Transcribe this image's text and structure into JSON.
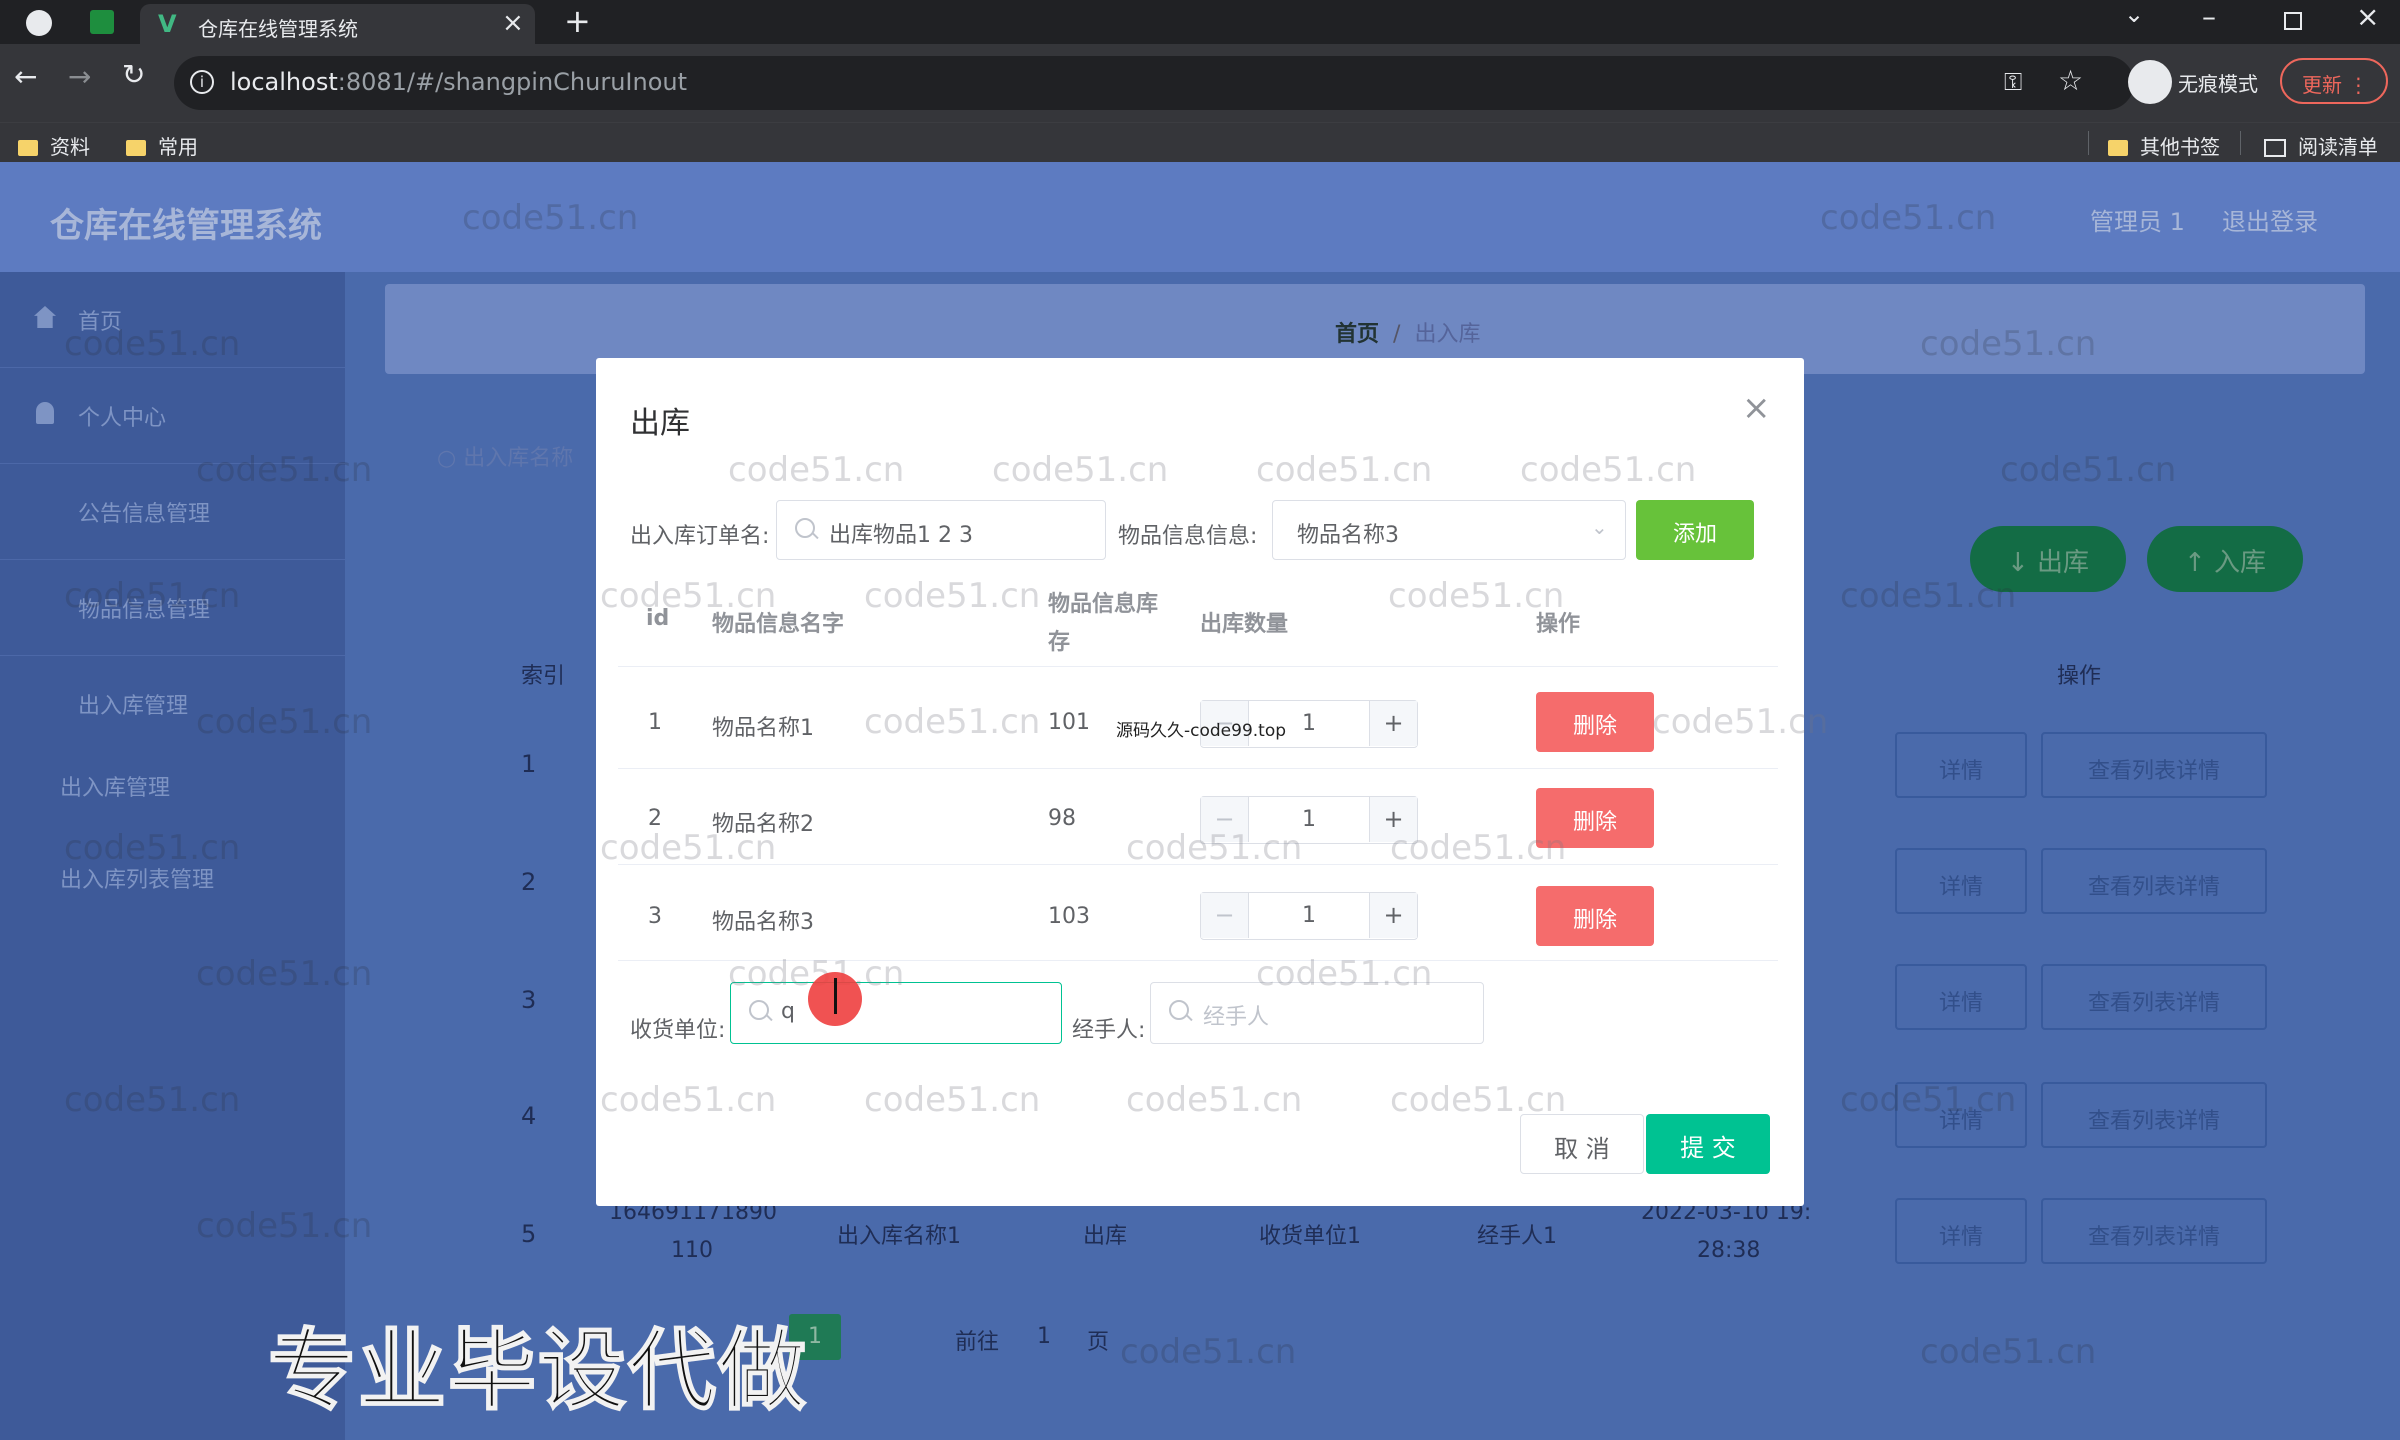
{
  "browser": {
    "tab_title": "仓库在线管理系统",
    "url_host": "localhost",
    "url_rest": ":8081/#/shangpinChuruInout",
    "incognito_label": "无痕模式",
    "update_label": "更新",
    "bookmarks": [
      "资料",
      "常用"
    ],
    "other_bookmarks": "其他书签",
    "reading_list": "阅读清单",
    "icons": [
      "back-icon",
      "forward-icon",
      "reload-icon",
      "info-icon",
      "key-icon",
      "star-icon",
      "tab-search-icon",
      "minimize-icon",
      "restore-icon",
      "close-window-icon"
    ]
  },
  "app": {
    "title": "仓库在线管理系统",
    "header_right": [
      "管理员 1",
      "退出登录"
    ],
    "sidebar": [
      {
        "label": "首页"
      },
      {
        "label": "个人中心"
      },
      {
        "label": "公告信息管理"
      },
      {
        "label": "物品信息管理"
      },
      {
        "label": "出入库管理"
      }
    ],
    "sidebar_sub": [
      "出入库管理",
      "出入库列表管理"
    ],
    "breadcrumb": {
      "home": "首页",
      "current": "出入库"
    },
    "search_placeholder": "出入库名称",
    "btn_out": "↓ 出库",
    "btn_in": "↑ 入库",
    "table_header_index": "索引",
    "table_header_ops": "操作",
    "row_indices": [
      "1",
      "2",
      "3",
      "4",
      "5"
    ],
    "row5": {
      "code_a": "164691171890",
      "code_b": "110",
      "name": "出入库名称1",
      "type": "出库",
      "unit": "收货单位1",
      "person": "经手人1",
      "time_a": "2022-03-10 19:",
      "time_b": "28:38"
    },
    "detail_btn": "详情",
    "list_detail_btn": "查看列表详情",
    "pagination": {
      "current": "1",
      "goto": "前往",
      "page_input": "1",
      "page_unit": "页"
    },
    "ad_text": "专业毕设代做"
  },
  "dialog": {
    "title": "出库",
    "order_name_label": "出入库订单名:",
    "order_name_value": "出库物品1 2 3",
    "item_info_label": "物品信息信息:",
    "item_info_value": "物品名称3",
    "add_btn": "添加",
    "columns": {
      "id": "id",
      "name": "物品信息名字",
      "stock_a": "物品信息库",
      "stock_b": "存",
      "qty": "出库数量",
      "ops": "操作"
    },
    "rows": [
      {
        "id": "1",
        "name": "物品名称1",
        "stock": "101",
        "qty": "1"
      },
      {
        "id": "2",
        "name": "物品名称2",
        "stock": "98",
        "qty": "1"
      },
      {
        "id": "3",
        "name": "物品名称3",
        "stock": "103",
        "qty": "1"
      }
    ],
    "delete_btn": "删除",
    "receiver_label": "收货单位:",
    "receiver_value": "q",
    "handler_label": "经手人:",
    "handler_placeholder": "经手人",
    "cancel_btn": "取 消",
    "submit_btn": "提 交",
    "overlay_text": "源码久久-code99.top"
  },
  "watermark": "code51.cn",
  "colors": {
    "primary": "#00c292",
    "add": "#67c23a",
    "danger": "#f56c6c",
    "header": "#5d7bc1",
    "sidebar": "#3e5a99"
  }
}
